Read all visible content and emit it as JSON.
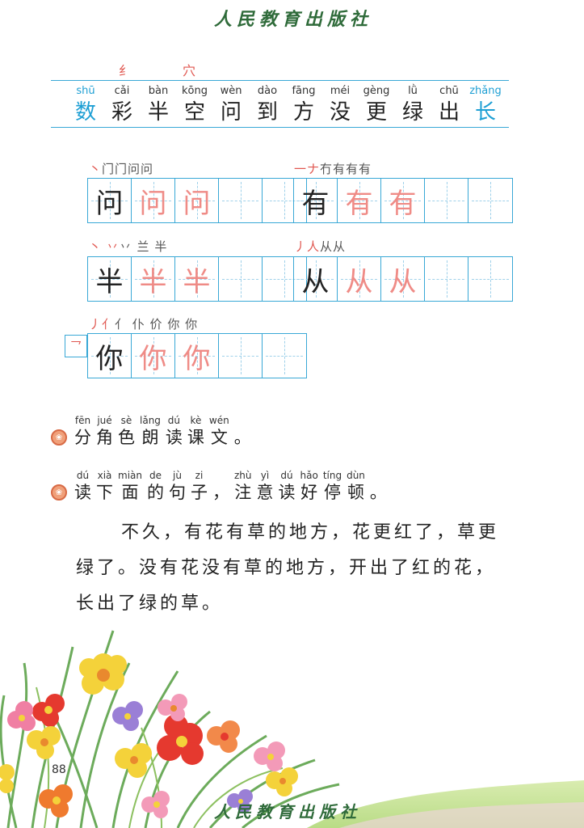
{
  "header": {
    "publisher": "人民教育出版社"
  },
  "word_row": {
    "radicals": [
      "纟",
      "穴"
    ],
    "chars": [
      {
        "py": "shū",
        "hz": "数",
        "blue": true
      },
      {
        "py": "cǎi",
        "hz": "彩",
        "blue": false
      },
      {
        "py": "bàn",
        "hz": "半",
        "blue": false
      },
      {
        "py": "kōng",
        "hz": "空",
        "blue": false
      },
      {
        "py": "wèn",
        "hz": "问",
        "blue": false
      },
      {
        "py": "dào",
        "hz": "到",
        "blue": false
      },
      {
        "py": "fāng",
        "hz": "方",
        "blue": false
      },
      {
        "py": "méi",
        "hz": "没",
        "blue": false
      },
      {
        "py": "gèng",
        "hz": "更",
        "blue": false
      },
      {
        "py": "lǜ",
        "hz": "绿",
        "blue": false
      },
      {
        "py": "chū",
        "hz": "出",
        "blue": false
      },
      {
        "py": "zhǎng",
        "hz": "长",
        "blue": true
      }
    ]
  },
  "writing": {
    "wen": {
      "strokes_first": "丶",
      "strokes_rest": "门门问问",
      "char": "问"
    },
    "you": {
      "strokes_first": "一ナ",
      "strokes_rest": "冇有有有",
      "char": "有"
    },
    "ban": {
      "strokes_first": "丶 丷",
      "strokes_rest": "丷 兰 半",
      "char": "半"
    },
    "cong": {
      "strokes_first": "丿人",
      "strokes_rest": "从从",
      "char": "从"
    },
    "ni": {
      "strokes_first": "丿亻",
      "strokes_rest": "亻 仆 价 你 你",
      "char": "你",
      "extra_stroke": "乛"
    }
  },
  "instructions": [
    {
      "words": [
        {
          "py": "fēn",
          "hz": "分"
        },
        {
          "py": "jué",
          "hz": "角"
        },
        {
          "py": "sè",
          "hz": "色"
        },
        {
          "py": "lǎng",
          "hz": "朗"
        },
        {
          "py": "dú",
          "hz": "读"
        },
        {
          "py": "kè",
          "hz": "课"
        },
        {
          "py": "wén",
          "hz": "文"
        },
        {
          "py": "",
          "hz": "。"
        }
      ]
    },
    {
      "words": [
        {
          "py": "dú",
          "hz": "读"
        },
        {
          "py": "xià",
          "hz": "下"
        },
        {
          "py": "miàn",
          "hz": "面"
        },
        {
          "py": "de",
          "hz": "的"
        },
        {
          "py": "jù",
          "hz": "句"
        },
        {
          "py": "zi",
          "hz": "子"
        },
        {
          "py": "",
          "hz": "，"
        },
        {
          "py": "zhù",
          "hz": "注"
        },
        {
          "py": "yì",
          "hz": "意"
        },
        {
          "py": "dú",
          "hz": "读"
        },
        {
          "py": "hǎo",
          "hz": "好"
        },
        {
          "py": "tíng",
          "hz": "停"
        },
        {
          "py": "dùn",
          "hz": "顿"
        },
        {
          "py": "",
          "hz": "。"
        }
      ]
    }
  ],
  "paragraph": {
    "line1": "不久，有花有草的地方，花更红了，草更",
    "line2": "绿了。没有花没有草的地方，开出了红的花，",
    "line3": "长出了绿的草。"
  },
  "footer": {
    "page_number": "88",
    "publisher": "人民教育出版社"
  },
  "colors": {
    "accent_blue": "#1e9fd4",
    "stroke_red": "#e0564f",
    "trace_pink": "#ef8b86"
  }
}
